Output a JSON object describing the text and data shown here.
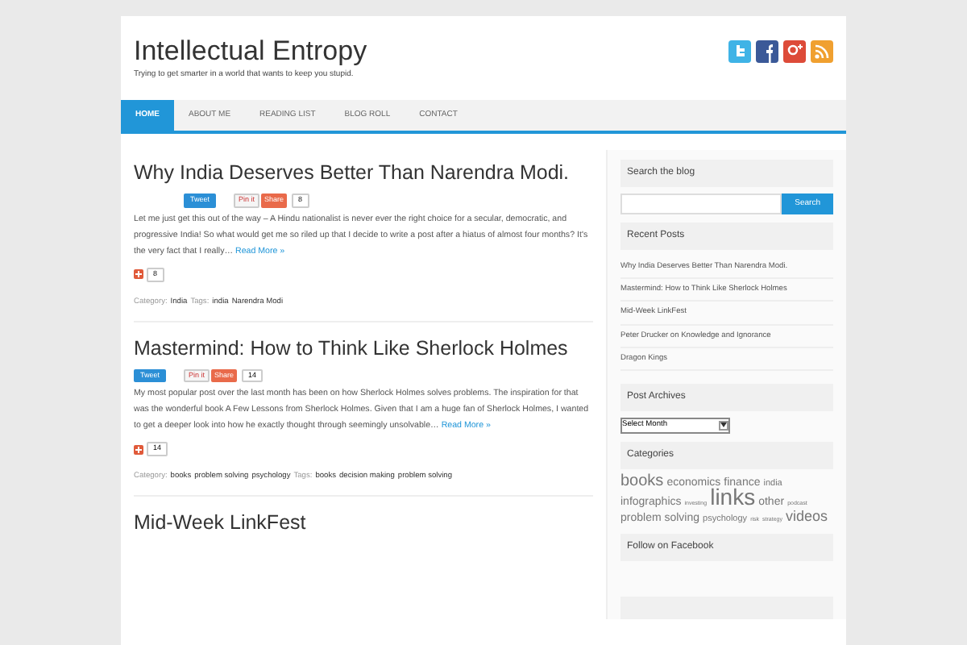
{
  "header": {
    "title": "Intellectual Entropy",
    "tagline": "Trying to get smarter in a world that wants to keep you stupid."
  },
  "nav": [
    {
      "label": "HOME",
      "selected": true
    },
    {
      "label": "ABOUT ME",
      "selected": false
    },
    {
      "label": "READING LIST",
      "selected": false
    },
    {
      "label": "BLOG ROLL",
      "selected": false
    },
    {
      "label": "CONTACT",
      "selected": false
    }
  ],
  "posts": [
    {
      "title": "Why India Deserves Better Than Narendra Modi.",
      "tweet": "Tweet",
      "pin": "Pin it",
      "share": "Share",
      "share_count": "8",
      "excerpt": "Let me just get this out of the way – A Hindu nationalist is never ever the right choice for a secular, democratic, and progressive India! So what would get me so riled up that I decide to write a post after a hiatus of almost four months? It's the very fact that I really…",
      "read_more": "Read More »",
      "plus_count": "8",
      "category_label": "Category:",
      "categories": [
        "India"
      ],
      "tags_label": "Tags:",
      "tags": [
        "india",
        "Narendra Modi"
      ]
    },
    {
      "title": "Mastermind: How to Think Like Sherlock Holmes",
      "tweet": "Tweet",
      "pin": "Pin it",
      "share": "Share",
      "share_count": "14",
      "excerpt": "My most popular post over the last month has been on how Sherlock Holmes solves problems. The inspiration for that was the wonderful book A Few Lessons from Sherlock Holmes. Given that I am a huge fan of Sherlock Holmes, I wanted to get a deeper look into how he exactly thought through seemingly unsolvable…",
      "read_more": "Read More »",
      "plus_count": "14",
      "category_label": "Category:",
      "categories": [
        "books",
        "problem solving",
        "psychology"
      ],
      "tags_label": "Tags:",
      "tags": [
        "books",
        "decision making",
        "problem solving"
      ]
    },
    {
      "title": "Mid-Week LinkFest"
    }
  ],
  "sidebar": {
    "search": {
      "heading": "Search the blog",
      "button": "Search"
    },
    "recent": {
      "heading": "Recent Posts",
      "items": [
        "Why India Deserves Better Than Narendra Modi.",
        "Mastermind: How to Think Like Sherlock Holmes",
        "Mid-Week LinkFest",
        "Peter Drucker on Knowledge and Ignorance",
        "Dragon Kings"
      ]
    },
    "archives": {
      "heading": "Post Archives",
      "select": "Select Month"
    },
    "categories": {
      "heading": "Categories",
      "tags": [
        {
          "label": "books",
          "kind": "xl"
        },
        {
          "label": "economics",
          "kind": "m"
        },
        {
          "label": "finance",
          "kind": "m"
        },
        {
          "label": "india",
          "kind": "s"
        },
        {
          "label": "infographics",
          "kind": "m"
        },
        {
          "label": "investing",
          "kind": "xs"
        },
        {
          "label": "links",
          "kind": "xxl"
        },
        {
          "label": "other",
          "kind": "m"
        },
        {
          "label": "podcast",
          "kind": "xs"
        },
        {
          "label": "problem solving",
          "kind": "m"
        },
        {
          "label": "psychology",
          "kind": "s"
        },
        {
          "label": "risk",
          "kind": "xs"
        },
        {
          "label": "strategy",
          "kind": "xs"
        },
        {
          "label": "videos",
          "kind": "l"
        }
      ]
    },
    "facebook": {
      "heading": "Follow on Facebook"
    }
  }
}
